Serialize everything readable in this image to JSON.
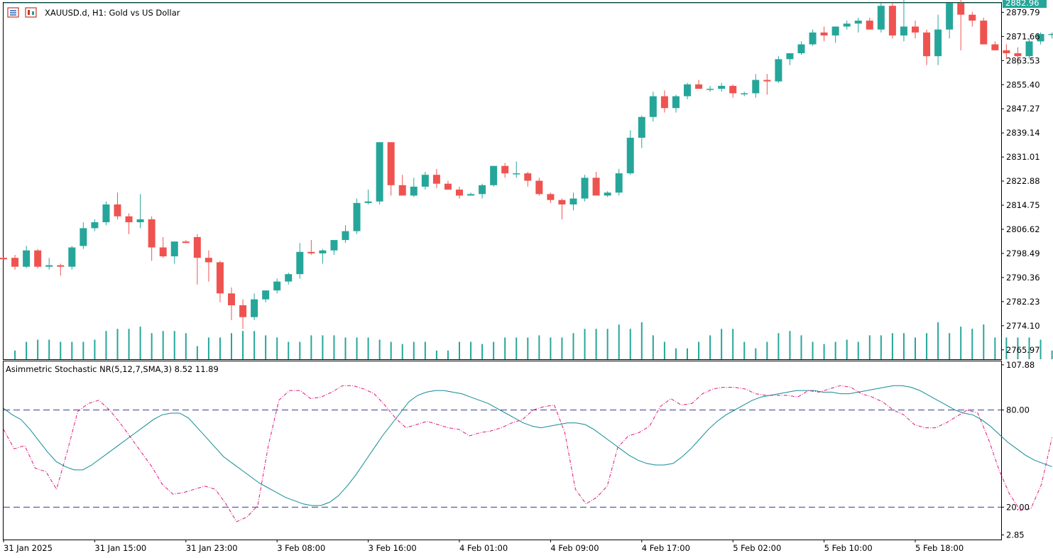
{
  "header": {
    "symbol_text": "XAUUSD.d, H1:  Gold vs US Dollar",
    "indicator_label": "Asimmetric Stochastic NR(5,12,7,SMA,3) 8.52 11.89"
  },
  "colors": {
    "bull": "#26a69a",
    "bear": "#ef5350",
    "volume": "#26a69a",
    "main_line": "#0f8b95",
    "signal_line": "#e0157a",
    "level_line": "#3d3d8f",
    "price_line": "#26a69a"
  },
  "chart_data": [
    {
      "type": "candlestick",
      "series_name": "XAUUSD.d, H1",
      "price_axis": {
        "labels": [
          "2879.79",
          "2871.66",
          "2863.53",
          "2855.40",
          "2847.27",
          "2839.14",
          "2831.01",
          "2822.88",
          "2814.75",
          "2806.62",
          "2798.49",
          "2790.36",
          "2782.23",
          "2774.10",
          "2765.97"
        ],
        "range": [
          2762.8,
          2883.0
        ]
      },
      "current_price": "2882.96",
      "time_labels": [
        "31 Jan 2025",
        "31 Jan 15:00",
        "31 Jan 23:00",
        "3 Feb 08:00",
        "3 Feb 16:00",
        "4 Feb 01:00",
        "4 Feb 09:00",
        "4 Feb 17:00",
        "5 Feb 02:00",
        "5 Feb 10:00",
        "5 Feb 18:00"
      ],
      "candles": [
        [
          2797,
          2797.5,
          2796,
          2796.5
        ],
        [
          2797,
          2798,
          2793,
          2794
        ],
        [
          2794,
          2801,
          2793.5,
          2799.5
        ],
        [
          2799.5,
          2800,
          2793.5,
          2794
        ],
        [
          2794,
          2797,
          2793,
          2794.5
        ],
        [
          2794.5,
          2795,
          2791,
          2794
        ],
        [
          2794,
          2801,
          2793,
          2800.5
        ],
        [
          2801,
          2809,
          2800,
          2807
        ],
        [
          2807,
          2810,
          2806,
          2809
        ],
        [
          2809,
          2816,
          2808,
          2815
        ],
        [
          2815,
          2819,
          2810,
          2811
        ],
        [
          2811,
          2812,
          2805,
          2809
        ],
        [
          2809,
          2818.5,
          2807,
          2810
        ],
        [
          2810,
          2811,
          2796,
          2800.5
        ],
        [
          2800.5,
          2804,
          2797,
          2797.5
        ],
        [
          2797.5,
          2802.5,
          2795,
          2802.5
        ],
        [
          2802.5,
          2803,
          2802,
          2802
        ],
        [
          2804,
          2805,
          2788,
          2797
        ],
        [
          2797,
          2799.5,
          2789,
          2795.5
        ],
        [
          2795.5,
          2796,
          2782,
          2785
        ],
        [
          2785,
          2787,
          2776,
          2781
        ],
        [
          2781,
          2783,
          2773,
          2777
        ],
        [
          2777,
          2785,
          2776,
          2783
        ],
        [
          2783,
          2786,
          2782,
          2786
        ],
        [
          2786,
          2790,
          2785,
          2789
        ],
        [
          2789,
          2792,
          2788,
          2791.5
        ],
        [
          2791.5,
          2802,
          2790,
          2799
        ],
        [
          2799,
          2803,
          2798,
          2798.5
        ],
        [
          2798.5,
          2800,
          2795,
          2799.5
        ],
        [
          2799.5,
          2803,
          2798,
          2803
        ],
        [
          2803,
          2808,
          2802,
          2806
        ],
        [
          2806,
          2817,
          2805,
          2815.5
        ],
        [
          2815.5,
          2820,
          2815,
          2816
        ],
        [
          2816,
          2836,
          2815,
          2836
        ],
        [
          2836,
          2836,
          2818,
          2821.5
        ],
        [
          2821.5,
          2825,
          2818,
          2818
        ],
        [
          2818,
          2824,
          2817.5,
          2821
        ],
        [
          2821,
          2826,
          2820,
          2825
        ],
        [
          2825,
          2827,
          2820.5,
          2822
        ],
        [
          2822,
          2823,
          2820,
          2820
        ],
        [
          2820,
          2821,
          2817,
          2818
        ],
        [
          2818,
          2819,
          2818,
          2818.5
        ],
        [
          2818.5,
          2822,
          2817,
          2821.5
        ],
        [
          2821.5,
          2828,
          2821,
          2828
        ],
        [
          2828,
          2829,
          2824,
          2825.5
        ],
        [
          2825.5,
          2829.5,
          2824,
          2825.5
        ],
        [
          2825.5,
          2826,
          2821,
          2823
        ],
        [
          2823,
          2824,
          2818,
          2818.5
        ],
        [
          2818.5,
          2819,
          2815.5,
          2816.5
        ],
        [
          2816.5,
          2817,
          2810,
          2815
        ],
        [
          2815,
          2819,
          2813,
          2817
        ],
        [
          2817,
          2825,
          2816,
          2824
        ],
        [
          2824,
          2826,
          2818,
          2818
        ],
        [
          2818,
          2819.5,
          2817.5,
          2819
        ],
        [
          2819,
          2827,
          2818,
          2825.5
        ],
        [
          2825.5,
          2840,
          2825,
          2837.5
        ],
        [
          2837.5,
          2845,
          2834,
          2844.5
        ],
        [
          2844.5,
          2853,
          2843,
          2851.5
        ],
        [
          2851.5,
          2853.5,
          2846,
          2847.5
        ],
        [
          2847.5,
          2852,
          2846,
          2851.5
        ],
        [
          2851.5,
          2856,
          2850.5,
          2855.5
        ],
        [
          2855.5,
          2857,
          2854,
          2854
        ],
        [
          2854,
          2855,
          2853,
          2854
        ],
        [
          2854,
          2856,
          2853,
          2855
        ],
        [
          2855,
          2855.5,
          2851,
          2852.5
        ],
        [
          2852.5,
          2853,
          2851.5,
          2852.5
        ],
        [
          2852.5,
          2859,
          2851,
          2857
        ],
        [
          2857,
          2859,
          2852,
          2856.5
        ],
        [
          2856.5,
          2865,
          2856,
          2864
        ],
        [
          2864,
          2866,
          2862,
          2866
        ],
        [
          2866,
          2870,
          2865.5,
          2869
        ],
        [
          2869,
          2874,
          2868.5,
          2873
        ],
        [
          2873,
          2875,
          2870,
          2872
        ],
        [
          2872,
          2875,
          2869.5,
          2875
        ],
        [
          2875,
          2877,
          2874,
          2876
        ],
        [
          2876,
          2878,
          2873,
          2877
        ],
        [
          2877,
          2878,
          2874,
          2874
        ],
        [
          2874,
          2883,
          2873,
          2882
        ],
        [
          2882,
          2883,
          2871,
          2872
        ],
        [
          2872,
          2885,
          2870,
          2875
        ],
        [
          2875,
          2877,
          2871,
          2873
        ],
        [
          2873,
          2874,
          2862,
          2865
        ],
        [
          2865,
          2879,
          2862,
          2874
        ],
        [
          2874,
          2883,
          2871,
          2883
        ],
        [
          2883,
          2884,
          2867,
          2879
        ],
        [
          2879,
          2880,
          2875,
          2877
        ],
        [
          2877,
          2878,
          2869,
          2869
        ],
        [
          2869,
          2870,
          2867,
          2867
        ],
        [
          2867,
          2869,
          2864,
          2866
        ],
        [
          2866,
          2868,
          2862,
          2865
        ],
        [
          2865,
          2871,
          2864,
          2870
        ],
        [
          2870,
          2873,
          2869,
          2872.5
        ],
        [
          2872.5,
          2873,
          2871,
          2872.5
        ]
      ],
      "volumes": [
        0,
        4,
        8,
        9,
        9,
        8,
        8,
        8,
        9,
        13,
        14,
        14,
        15,
        12,
        13,
        13,
        12,
        6,
        10,
        10,
        12,
        13,
        13,
        11,
        10,
        8,
        8,
        11,
        11,
        11,
        10,
        10,
        10,
        9,
        8,
        7,
        8,
        8,
        4,
        4,
        8,
        8,
        7,
        8,
        10,
        10,
        10,
        11,
        10,
        10,
        12,
        14,
        14,
        14,
        16,
        14,
        17,
        11,
        8,
        5,
        5,
        8,
        11,
        14,
        14,
        8,
        5,
        8,
        12,
        13,
        11,
        8,
        7,
        8,
        9,
        8,
        11,
        11,
        12,
        12,
        10,
        12,
        17,
        12,
        15,
        14,
        16,
        10,
        10,
        10,
        10,
        9,
        4,
        4,
        3
      ]
    },
    {
      "type": "line",
      "series_name": "Asimmetric Stochastic NR(5,12,7,SMA,3)",
      "ylim": [
        0,
        110
      ],
      "y_axis_labels": [
        "107.88",
        "80.00",
        "20.00",
        "2.85"
      ],
      "levels": [
        80,
        20
      ],
      "main_line": [
        81,
        77,
        74,
        68,
        61,
        54,
        48,
        45,
        43,
        43,
        46,
        50,
        54,
        58,
        62,
        66,
        70,
        74,
        77,
        78,
        78,
        75,
        69,
        63,
        57,
        51,
        47,
        43,
        39,
        35,
        32,
        29,
        26,
        24,
        22,
        21,
        21,
        23,
        27,
        33,
        40,
        48,
        56,
        64,
        71,
        78,
        85,
        89,
        91,
        92,
        92,
        91,
        90,
        88,
        86,
        84,
        81,
        78,
        75,
        72,
        70,
        69,
        70,
        71,
        72,
        72,
        71,
        68,
        64,
        60,
        56,
        52,
        49,
        47,
        46,
        46,
        47,
        51,
        56,
        62,
        68,
        73,
        77,
        80,
        83,
        86,
        88,
        89,
        90,
        91,
        92,
        92,
        92,
        91,
        91,
        90,
        90,
        91,
        92,
        93,
        94,
        95,
        95,
        94,
        92,
        89,
        86,
        83,
        80,
        78,
        77,
        74,
        70,
        65,
        60,
        56,
        52,
        49,
        47,
        45
      ],
      "signal_line": [
        68,
        56,
        58,
        44,
        42,
        31,
        54,
        79,
        84,
        86,
        80,
        72,
        63,
        54,
        45,
        34,
        28,
        29,
        31,
        33,
        31,
        22,
        11,
        14,
        21,
        58,
        86,
        92,
        92,
        87,
        88,
        91,
        95,
        95,
        93,
        90,
        83,
        75,
        69,
        71,
        73,
        71,
        69,
        68,
        64,
        66,
        67,
        69,
        72,
        74,
        80,
        82,
        83,
        66,
        31,
        22,
        26,
        33,
        57,
        64,
        66,
        70,
        82,
        87,
        83,
        84,
        90,
        93,
        94,
        94,
        93,
        90,
        89,
        89,
        89,
        88,
        92,
        91,
        93,
        95,
        94,
        90,
        88,
        85,
        80,
        77,
        71,
        69,
        69,
        72,
        76,
        80,
        78,
        62,
        43,
        28,
        18,
        19,
        34,
        63
      ]
    }
  ]
}
